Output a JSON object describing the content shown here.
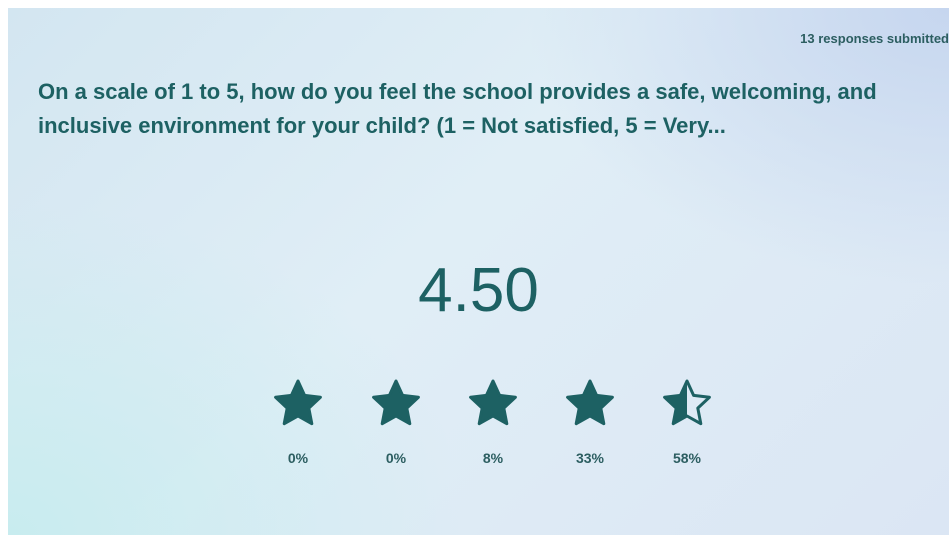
{
  "responses": "13 responses submitted",
  "question": "On a scale of 1 to 5, how do you feel the school provides a safe, welcoming, and inclusive environment for your child? (1 = Not satisfied, 5 = Very...",
  "average": "4.50",
  "average_value": 4.5,
  "accent_color": "#1d6163",
  "stars": [
    {
      "rating": 1,
      "percent": "0%",
      "fill": 1.0,
      "icon": "star-filled-icon"
    },
    {
      "rating": 2,
      "percent": "0%",
      "fill": 1.0,
      "icon": "star-filled-icon"
    },
    {
      "rating": 3,
      "percent": "8%",
      "fill": 1.0,
      "icon": "star-filled-icon"
    },
    {
      "rating": 4,
      "percent": "33%",
      "fill": 1.0,
      "icon": "star-filled-icon"
    },
    {
      "rating": 5,
      "percent": "58%",
      "fill": 0.5,
      "icon": "star-half-icon"
    }
  ]
}
